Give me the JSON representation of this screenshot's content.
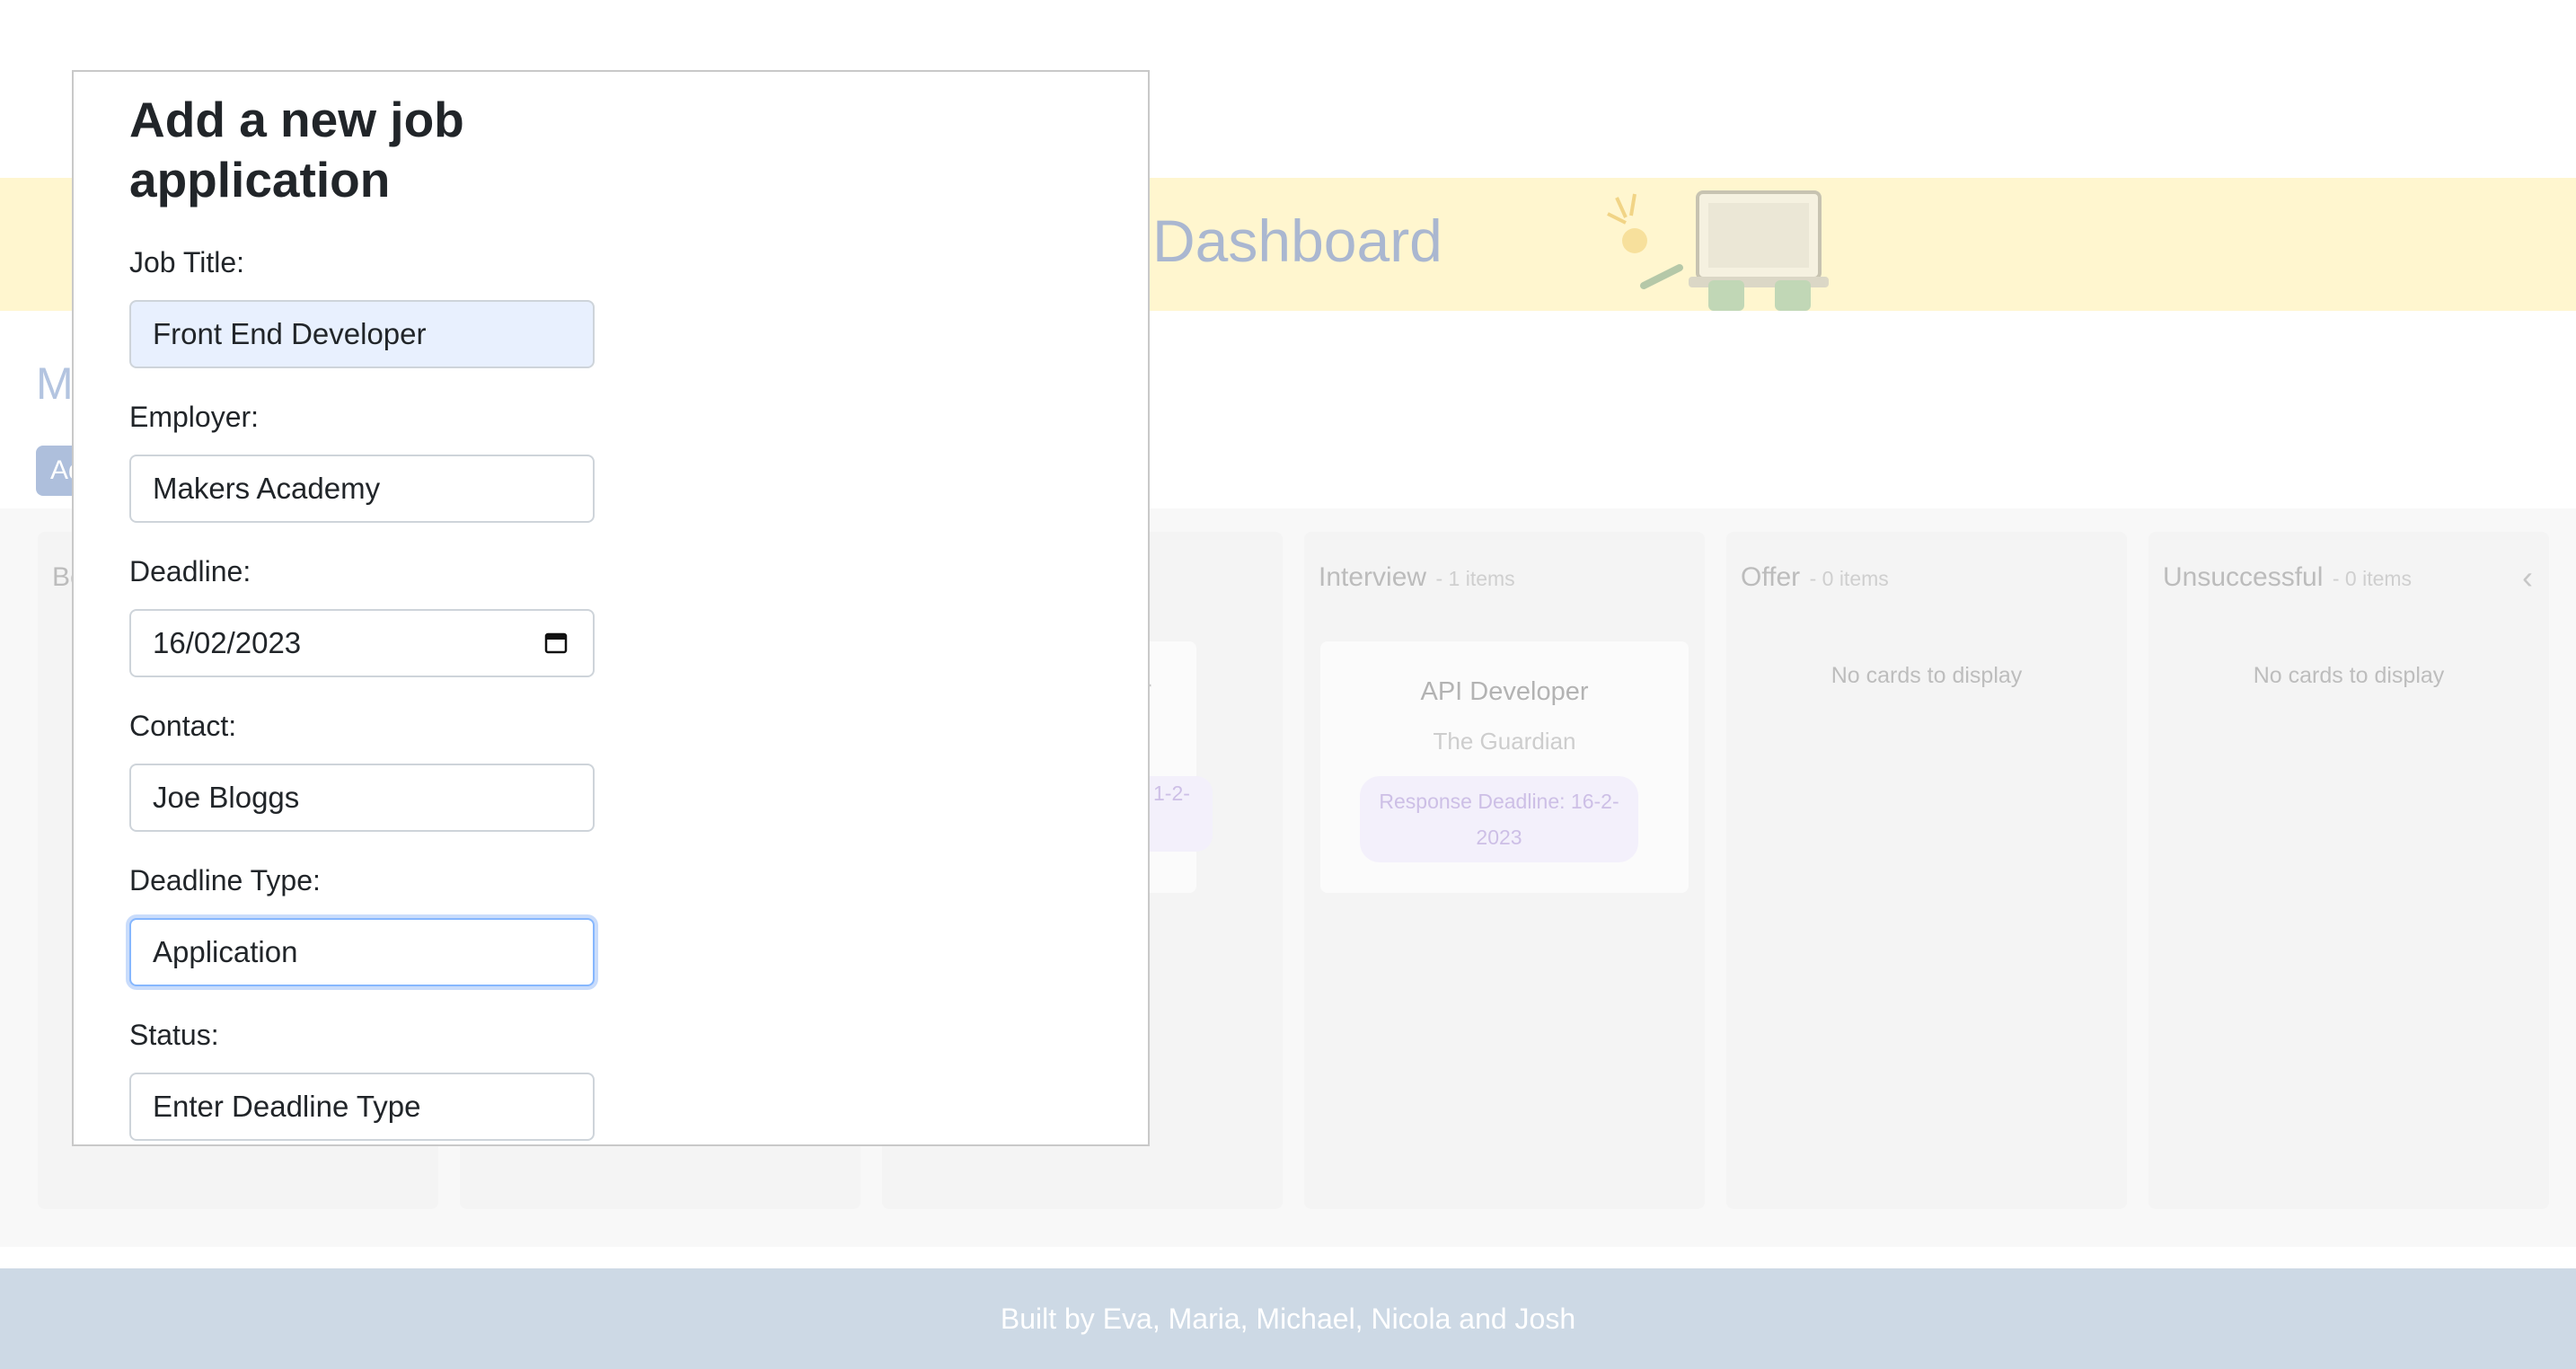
{
  "dashboard": {
    "banner_title": "Dashboard",
    "page_heading_stub": "M",
    "add_button_stub": "Ad",
    "columns": [
      {
        "name": "Be",
        "count_text": ""
      },
      {
        "name": "",
        "count_text": ""
      },
      {
        "name": "",
        "count_text": ""
      },
      {
        "name": "Interview",
        "count_text": "- 1 items"
      },
      {
        "name": "Offer",
        "count_text": "- 0 items"
      },
      {
        "name": "Unsuccessful",
        "count_text": "- 0 items"
      }
    ],
    "empty_message": "No cards to display",
    "partial_card": {
      "title_fragment": "per",
      "pill_fragment": "1-2-"
    },
    "interview_card": {
      "title": "API Developer",
      "employer": "The Guardian",
      "deadline": "Response Deadline: 16-2-2023"
    }
  },
  "modal": {
    "title": "Add a new job application",
    "fields": {
      "job_title": {
        "label": "Job Title:",
        "value": "Front End Developer"
      },
      "employer": {
        "label": "Employer:",
        "value": "Makers Academy"
      },
      "deadline": {
        "label": "Deadline:",
        "value": "16/02/2023"
      },
      "contact": {
        "label": "Contact:",
        "value": "Joe Bloggs"
      },
      "deadline_type": {
        "label": "Deadline Type:",
        "value": "Application"
      },
      "status": {
        "label": "Status:",
        "placeholder": "Enter Deadline Type"
      }
    }
  },
  "footer": {
    "text": "Built by Eva, Maria, Michael, Nicola and Josh"
  },
  "icons": {
    "calendar": "calendar-icon",
    "collapse": "chevron-left-icon",
    "illustration": "laptop-illustration"
  },
  "colors": {
    "banner": "#fff6cf",
    "footer": "#cdd9e5",
    "focus": "#86b7fe",
    "autofill": "#e8f0fe"
  }
}
